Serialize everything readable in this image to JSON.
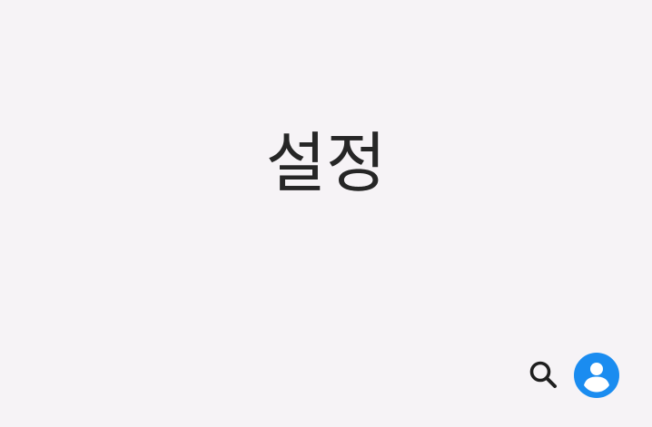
{
  "header": {
    "title": "설정"
  },
  "actions": {
    "search_icon": "search-icon",
    "profile_icon": "account-circle-icon"
  },
  "colors": {
    "background": "#f6f3f6",
    "title_text": "#262626",
    "search_icon": "#1f1f1f",
    "profile_accent": "#1a8cf0"
  }
}
